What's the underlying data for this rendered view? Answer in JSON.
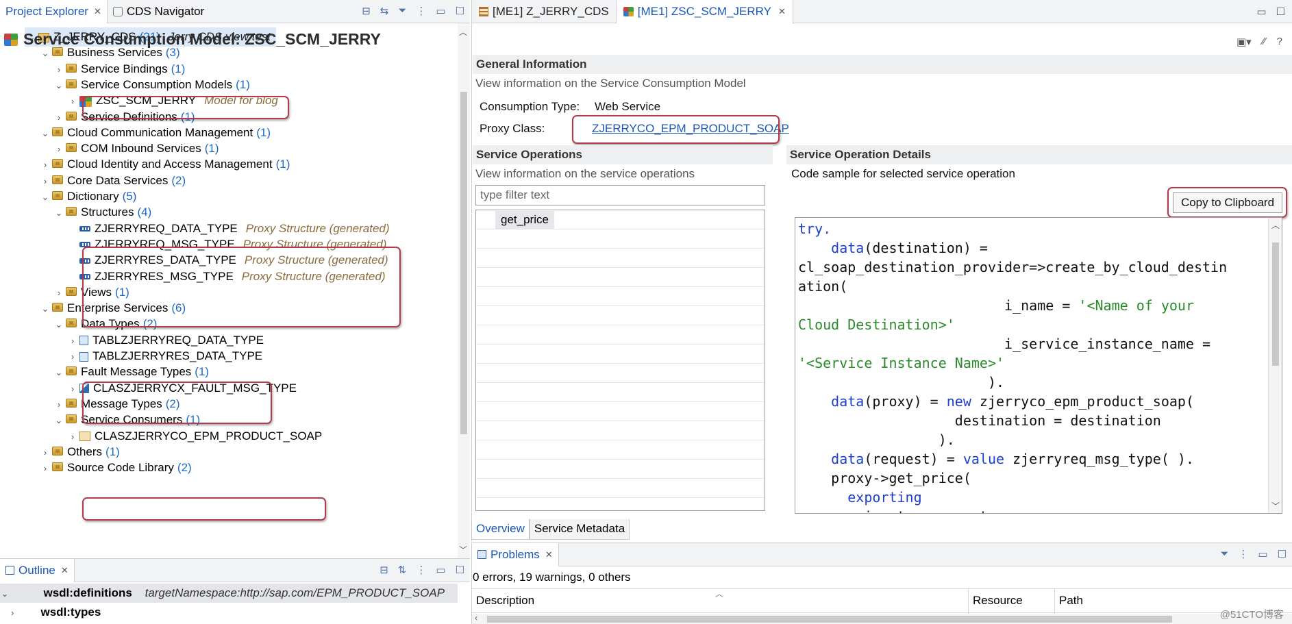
{
  "left": {
    "tabs": [
      {
        "label": "Project Explorer",
        "active": true
      },
      {
        "label": "CDS Navigator",
        "active": false
      }
    ],
    "tree": [
      {
        "label": "Z_JERRY_CDS",
        "count": "(21)",
        "desc": "Jerry CDS view test",
        "indent": 0,
        "chev": "⌄",
        "icon": "package-icon"
      },
      {
        "label": "Business Services",
        "count": "(3)",
        "indent": 1,
        "chev": "⌄",
        "icon": "folder-icon"
      },
      {
        "label": "Service Bindings",
        "count": "(1)",
        "indent": 2,
        "chev": "›",
        "icon": "folder-icon"
      },
      {
        "label": "Service Consumption Models",
        "count": "(1)",
        "indent": 2,
        "chev": "⌄",
        "icon": "folder-icon"
      },
      {
        "label": "ZSC_SCM_JERRY",
        "desc": "Model for blog",
        "indent": 3,
        "chev": "›",
        "icon": "scm-icon"
      },
      {
        "label": "Service Definitions",
        "count": "(1)",
        "indent": 2,
        "chev": "›",
        "icon": "folder-icon"
      },
      {
        "label": "Cloud Communication Management",
        "count": "(1)",
        "indent": 1,
        "chev": "⌄",
        "icon": "folder-icon"
      },
      {
        "label": "COM Inbound Services",
        "count": "(1)",
        "indent": 2,
        "chev": "›",
        "icon": "folder-icon"
      },
      {
        "label": "Cloud Identity and Access Management",
        "count": "(1)",
        "indent": 1,
        "chev": "›",
        "icon": "folder-icon"
      },
      {
        "label": "Core Data Services",
        "count": "(2)",
        "indent": 1,
        "chev": "›",
        "icon": "folder-icon"
      },
      {
        "label": "Dictionary",
        "count": "(5)",
        "indent": 1,
        "chev": "⌄",
        "icon": "folder-icon"
      },
      {
        "label": "Structures",
        "count": "(4)",
        "indent": 2,
        "chev": "⌄",
        "icon": "folder-icon"
      },
      {
        "label": "ZJERRYREQ_DATA_TYPE",
        "desc": "Proxy Structure (generated)",
        "indent": 3,
        "chev": "",
        "icon": "structure-icon"
      },
      {
        "label": "ZJERRYREQ_MSG_TYPE",
        "desc": "Proxy Structure (generated)",
        "indent": 3,
        "chev": "",
        "icon": "structure-icon"
      },
      {
        "label": "ZJERRYRES_DATA_TYPE",
        "desc": "Proxy Structure (generated)",
        "indent": 3,
        "chev": "",
        "icon": "structure-icon"
      },
      {
        "label": "ZJERRYRES_MSG_TYPE",
        "desc": "Proxy Structure (generated)",
        "indent": 3,
        "chev": "",
        "icon": "structure-icon"
      },
      {
        "label": "Views",
        "count": "(1)",
        "indent": 2,
        "chev": "›",
        "icon": "folder-icon"
      },
      {
        "label": "Enterprise Services",
        "count": "(6)",
        "indent": 1,
        "chev": "⌄",
        "icon": "folder-icon"
      },
      {
        "label": "Data Types",
        "count": "(2)",
        "indent": 2,
        "chev": "⌄",
        "icon": "folder-icon"
      },
      {
        "label": "TABLZJERRYREQ_DATA_TYPE",
        "indent": 3,
        "chev": "›",
        "icon": "type-icon"
      },
      {
        "label": "TABLZJERRYRES_DATA_TYPE",
        "indent": 3,
        "chev": "›",
        "icon": "type-icon"
      },
      {
        "label": "Fault Message Types",
        "count": "(1)",
        "indent": 2,
        "chev": "⌄",
        "icon": "folder-icon"
      },
      {
        "label": "CLASZJERRYCX_FAULT_MSG_TYPE",
        "indent": 3,
        "chev": "›",
        "icon": "class-icon"
      },
      {
        "label": "Message Types",
        "count": "(2)",
        "indent": 2,
        "chev": "›",
        "icon": "folder-icon"
      },
      {
        "label": "Service Consumers",
        "count": "(1)",
        "indent": 2,
        "chev": "⌄",
        "icon": "folder-icon"
      },
      {
        "label": "CLASZJERRYCO_EPM_PRODUCT_SOAP",
        "indent": 3,
        "chev": "›",
        "icon": "consumer-icon"
      },
      {
        "label": "Others",
        "count": "(1)",
        "indent": 1,
        "chev": "›",
        "icon": "folder-icon"
      },
      {
        "label": "Source Code Library",
        "count": "(2)",
        "indent": 1,
        "chev": "›",
        "icon": "folder-icon"
      }
    ]
  },
  "outline": {
    "tab": "Outline",
    "rows": [
      {
        "label": "wsdl:definitions",
        "attr": "targetNamespace:http://sap.com/EPM_PRODUCT_SOAP"
      },
      {
        "label": "wsdl:types",
        "attr": ""
      }
    ]
  },
  "editor": {
    "tabs": [
      {
        "label": "[ME1] Z_JERRY_CDS",
        "active": false
      },
      {
        "label": "[ME1] ZSC_SCM_JERRY",
        "active": true
      }
    ],
    "title": "Service Consumption Model: ZSC_SCM_JERRY",
    "general": {
      "heading": "General Information",
      "desc": "View information on the Service Consumption Model",
      "consumption_label": "Consumption Type:",
      "consumption_value": "Web Service",
      "proxy_label": "Proxy Class:",
      "proxy_value": "ZJERRYCO_EPM_PRODUCT_SOAP"
    },
    "operations": {
      "heading": "Service Operations",
      "desc": "View information on the service operations",
      "filter_placeholder": "type filter text",
      "items": [
        "get_price"
      ]
    },
    "details": {
      "heading": "Service Operation Details",
      "desc": "Code sample for selected service operation",
      "copy_label": "Copy to Clipboard"
    },
    "bottom_tabs": [
      {
        "label": "Overview",
        "active": true
      },
      {
        "label": "Service Metadata",
        "active": false
      }
    ]
  },
  "code_lines": [
    [
      {
        "t": "try.",
        "c": "kw"
      }
    ],
    [
      {
        "t": "    "
      },
      {
        "t": "data",
        "c": "kw"
      },
      {
        "t": "(destination) ="
      }
    ],
    [
      {
        "t": "cl_soap_destination_provider=>create_by_cloud_destin"
      }
    ],
    [
      {
        "t": "ation("
      }
    ],
    [
      {
        "t": "                         i_name = "
      },
      {
        "t": "'<Name of your",
        "c": "str"
      }
    ],
    [
      {
        "t": "Cloud Destination>'",
        "c": "str"
      }
    ],
    [
      {
        "t": "                         i_service_instance_name ="
      }
    ],
    [
      {
        "t": "'<Service Instance Name>'",
        "c": "str"
      }
    ],
    [
      {
        "t": "                       )."
      }
    ],
    [
      {
        "t": "    "
      },
      {
        "t": "data",
        "c": "kw"
      },
      {
        "t": "(proxy) = "
      },
      {
        "t": "new",
        "c": "kw"
      },
      {
        "t": " zjerryco_epm_product_soap("
      }
    ],
    [
      {
        "t": "                   destination = destination"
      }
    ],
    [
      {
        "t": "                 )."
      }
    ],
    [
      {
        "t": "    "
      },
      {
        "t": "data",
        "c": "kw"
      },
      {
        "t": "(request) = "
      },
      {
        "t": "value",
        "c": "kw"
      },
      {
        "t": " zjerryreq_msg_type( )."
      }
    ],
    [
      {
        "t": "    proxy->get_price("
      }
    ],
    [
      {
        "t": "      "
      },
      {
        "t": "exporting",
        "c": "kw"
      }
    ],
    [
      {
        "t": "        input = request"
      }
    ]
  ],
  "problems": {
    "tab": "Problems",
    "summary": "0 errors, 19 warnings, 0 others",
    "columns": [
      "Description",
      "Resource",
      "Path"
    ]
  },
  "watermark": "@51CTO博客"
}
